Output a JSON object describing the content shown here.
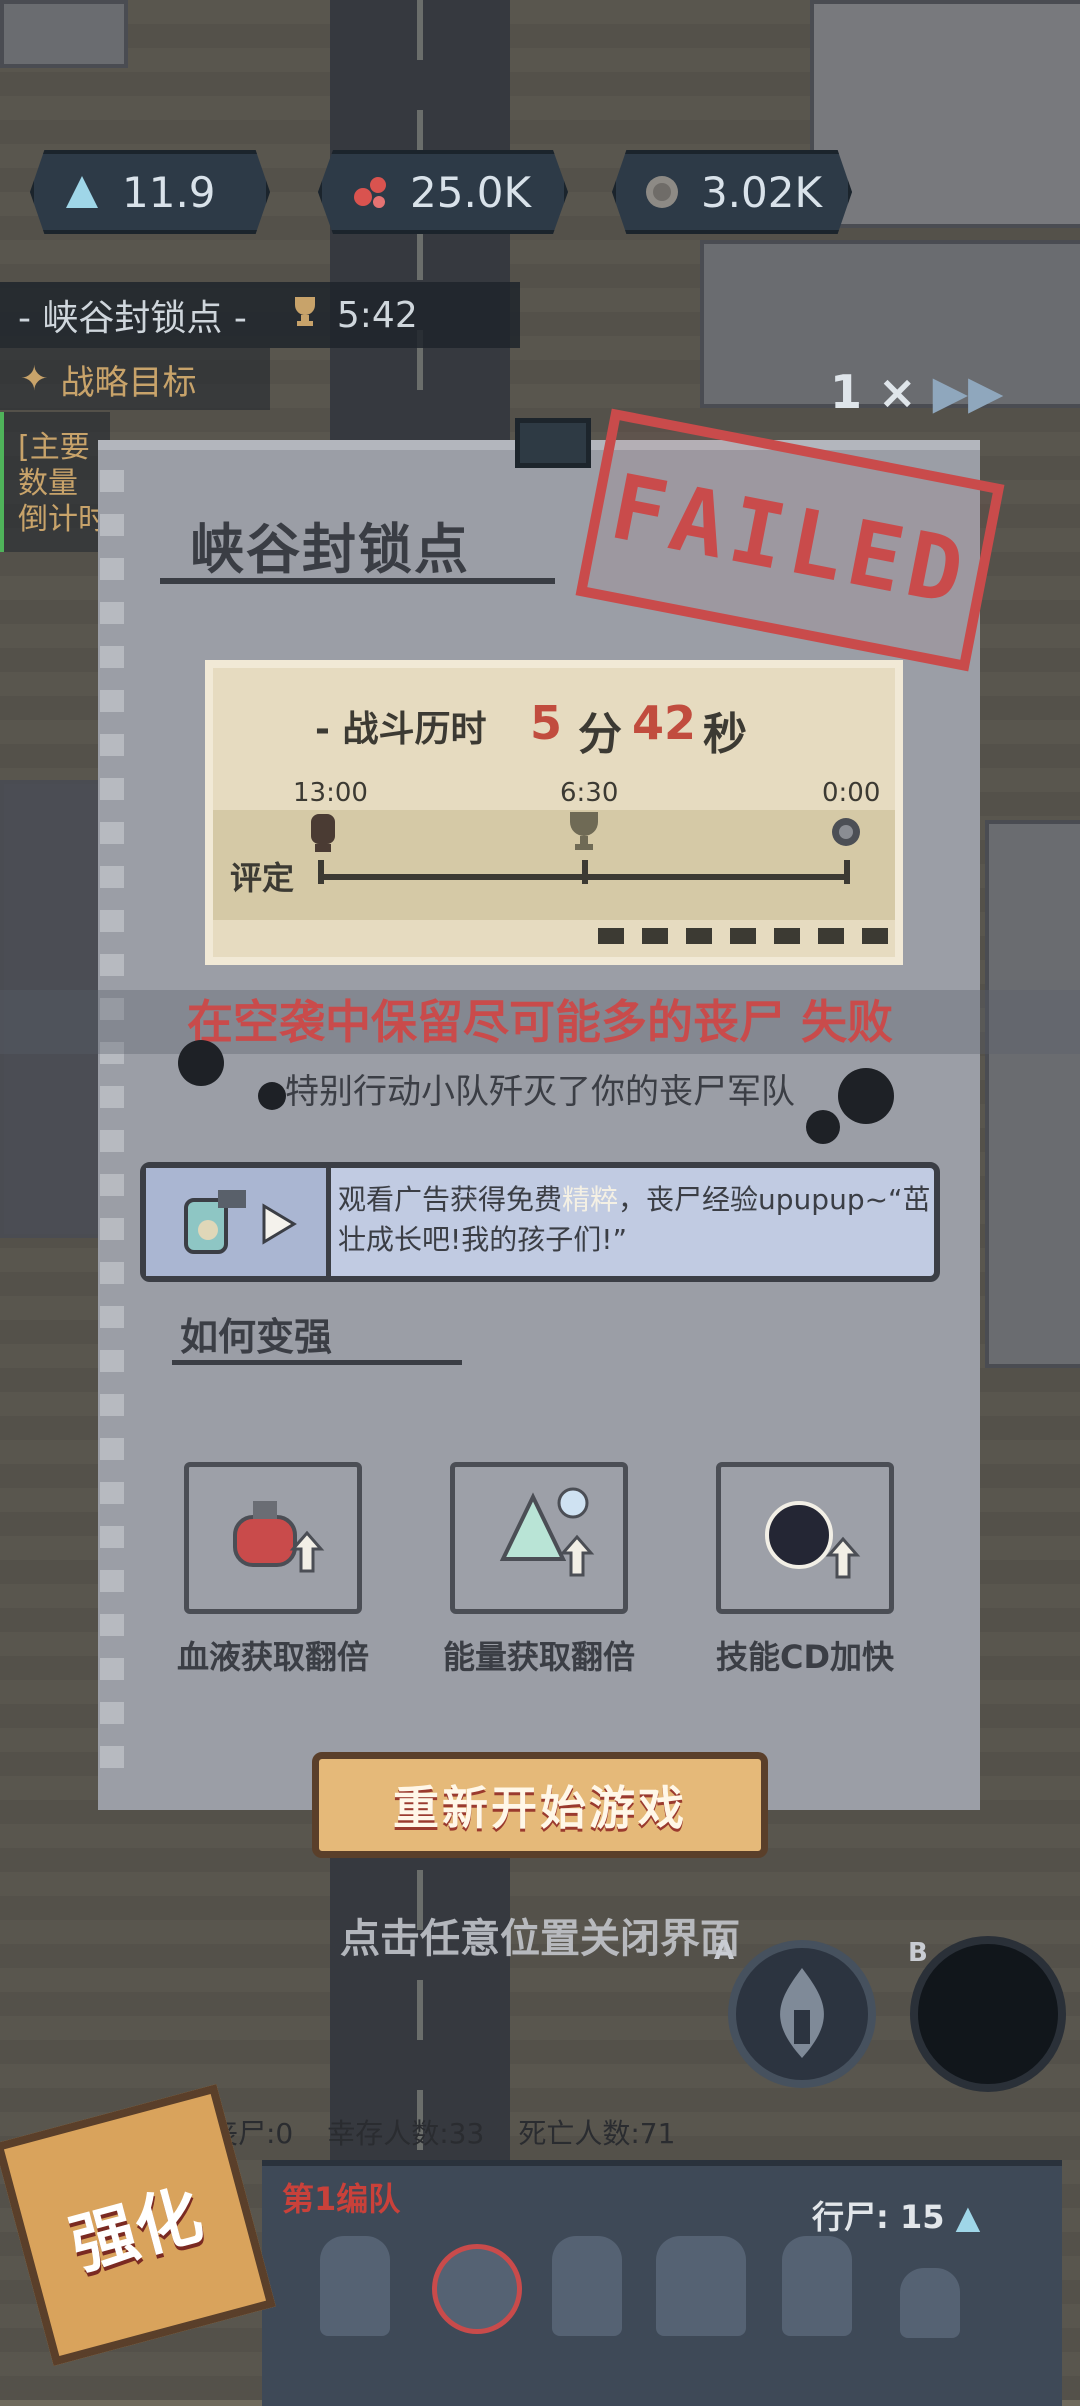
{
  "top_stats": [
    {
      "icon": "energy-triangle-icon",
      "value": "11.9"
    },
    {
      "icon": "blood-cells-icon",
      "value": "25.0K"
    },
    {
      "icon": "skull-coin-icon",
      "value": "3.02K"
    }
  ],
  "speed": {
    "label": "1 ×",
    "icon": "fast-forward-icon"
  },
  "objective": {
    "title": "- 峡谷封锁点 -",
    "timer": "5:42",
    "strategy_label": "战略目标",
    "side_lines": [
      "[主要",
      "数量",
      "倒计时"
    ]
  },
  "card": {
    "title": "峡谷封锁点",
    "stamp": "FAILED",
    "battle_time_label": "- 战斗历时",
    "minutes": "5",
    "minutes_unit": "分",
    "seconds": "42",
    "seconds_unit": "秒",
    "ticks": [
      "13:00",
      "6:30",
      "0:00"
    ],
    "rating_label": "评定",
    "fail_message": "在空袭中保留尽可能多的丧尸 失败",
    "fail_reason": "特别行动小队歼灭了你的丧尸军队",
    "ad": {
      "text_before": "观看广告获得免费",
      "highlight": "精粹",
      "text_after": "，丧尸经验upupup~“茁壮成长吧!我的孩子们!”"
    },
    "howto_title": "如何变强",
    "tips": [
      {
        "label": "血液获取翻倍",
        "icon": "blood-potion-upgrade-icon"
      },
      {
        "label": "能量获取翻倍",
        "icon": "energy-crystal-upgrade-icon"
      },
      {
        "label": "技能CD加快",
        "icon": "dark-orb-upgrade-icon"
      }
    ],
    "restart_label": "重新开始游戏"
  },
  "close_hint": "点击任意位置关闭界面",
  "buttons": {
    "a_label": "A",
    "b_label": "B"
  },
  "bottom": {
    "zombies": "丧尸:0",
    "survivors": "幸存人数:33",
    "dead": "死亡人数:71",
    "squad_name": "第1编队",
    "walkers": "行尸: 15",
    "upgrade_label": "强化"
  },
  "colors": {
    "fail_red": "#c94b4b",
    "time_red": "#c14c3e",
    "card_gray": "#9b9ea6",
    "restart_orange": "#e5b979"
  }
}
